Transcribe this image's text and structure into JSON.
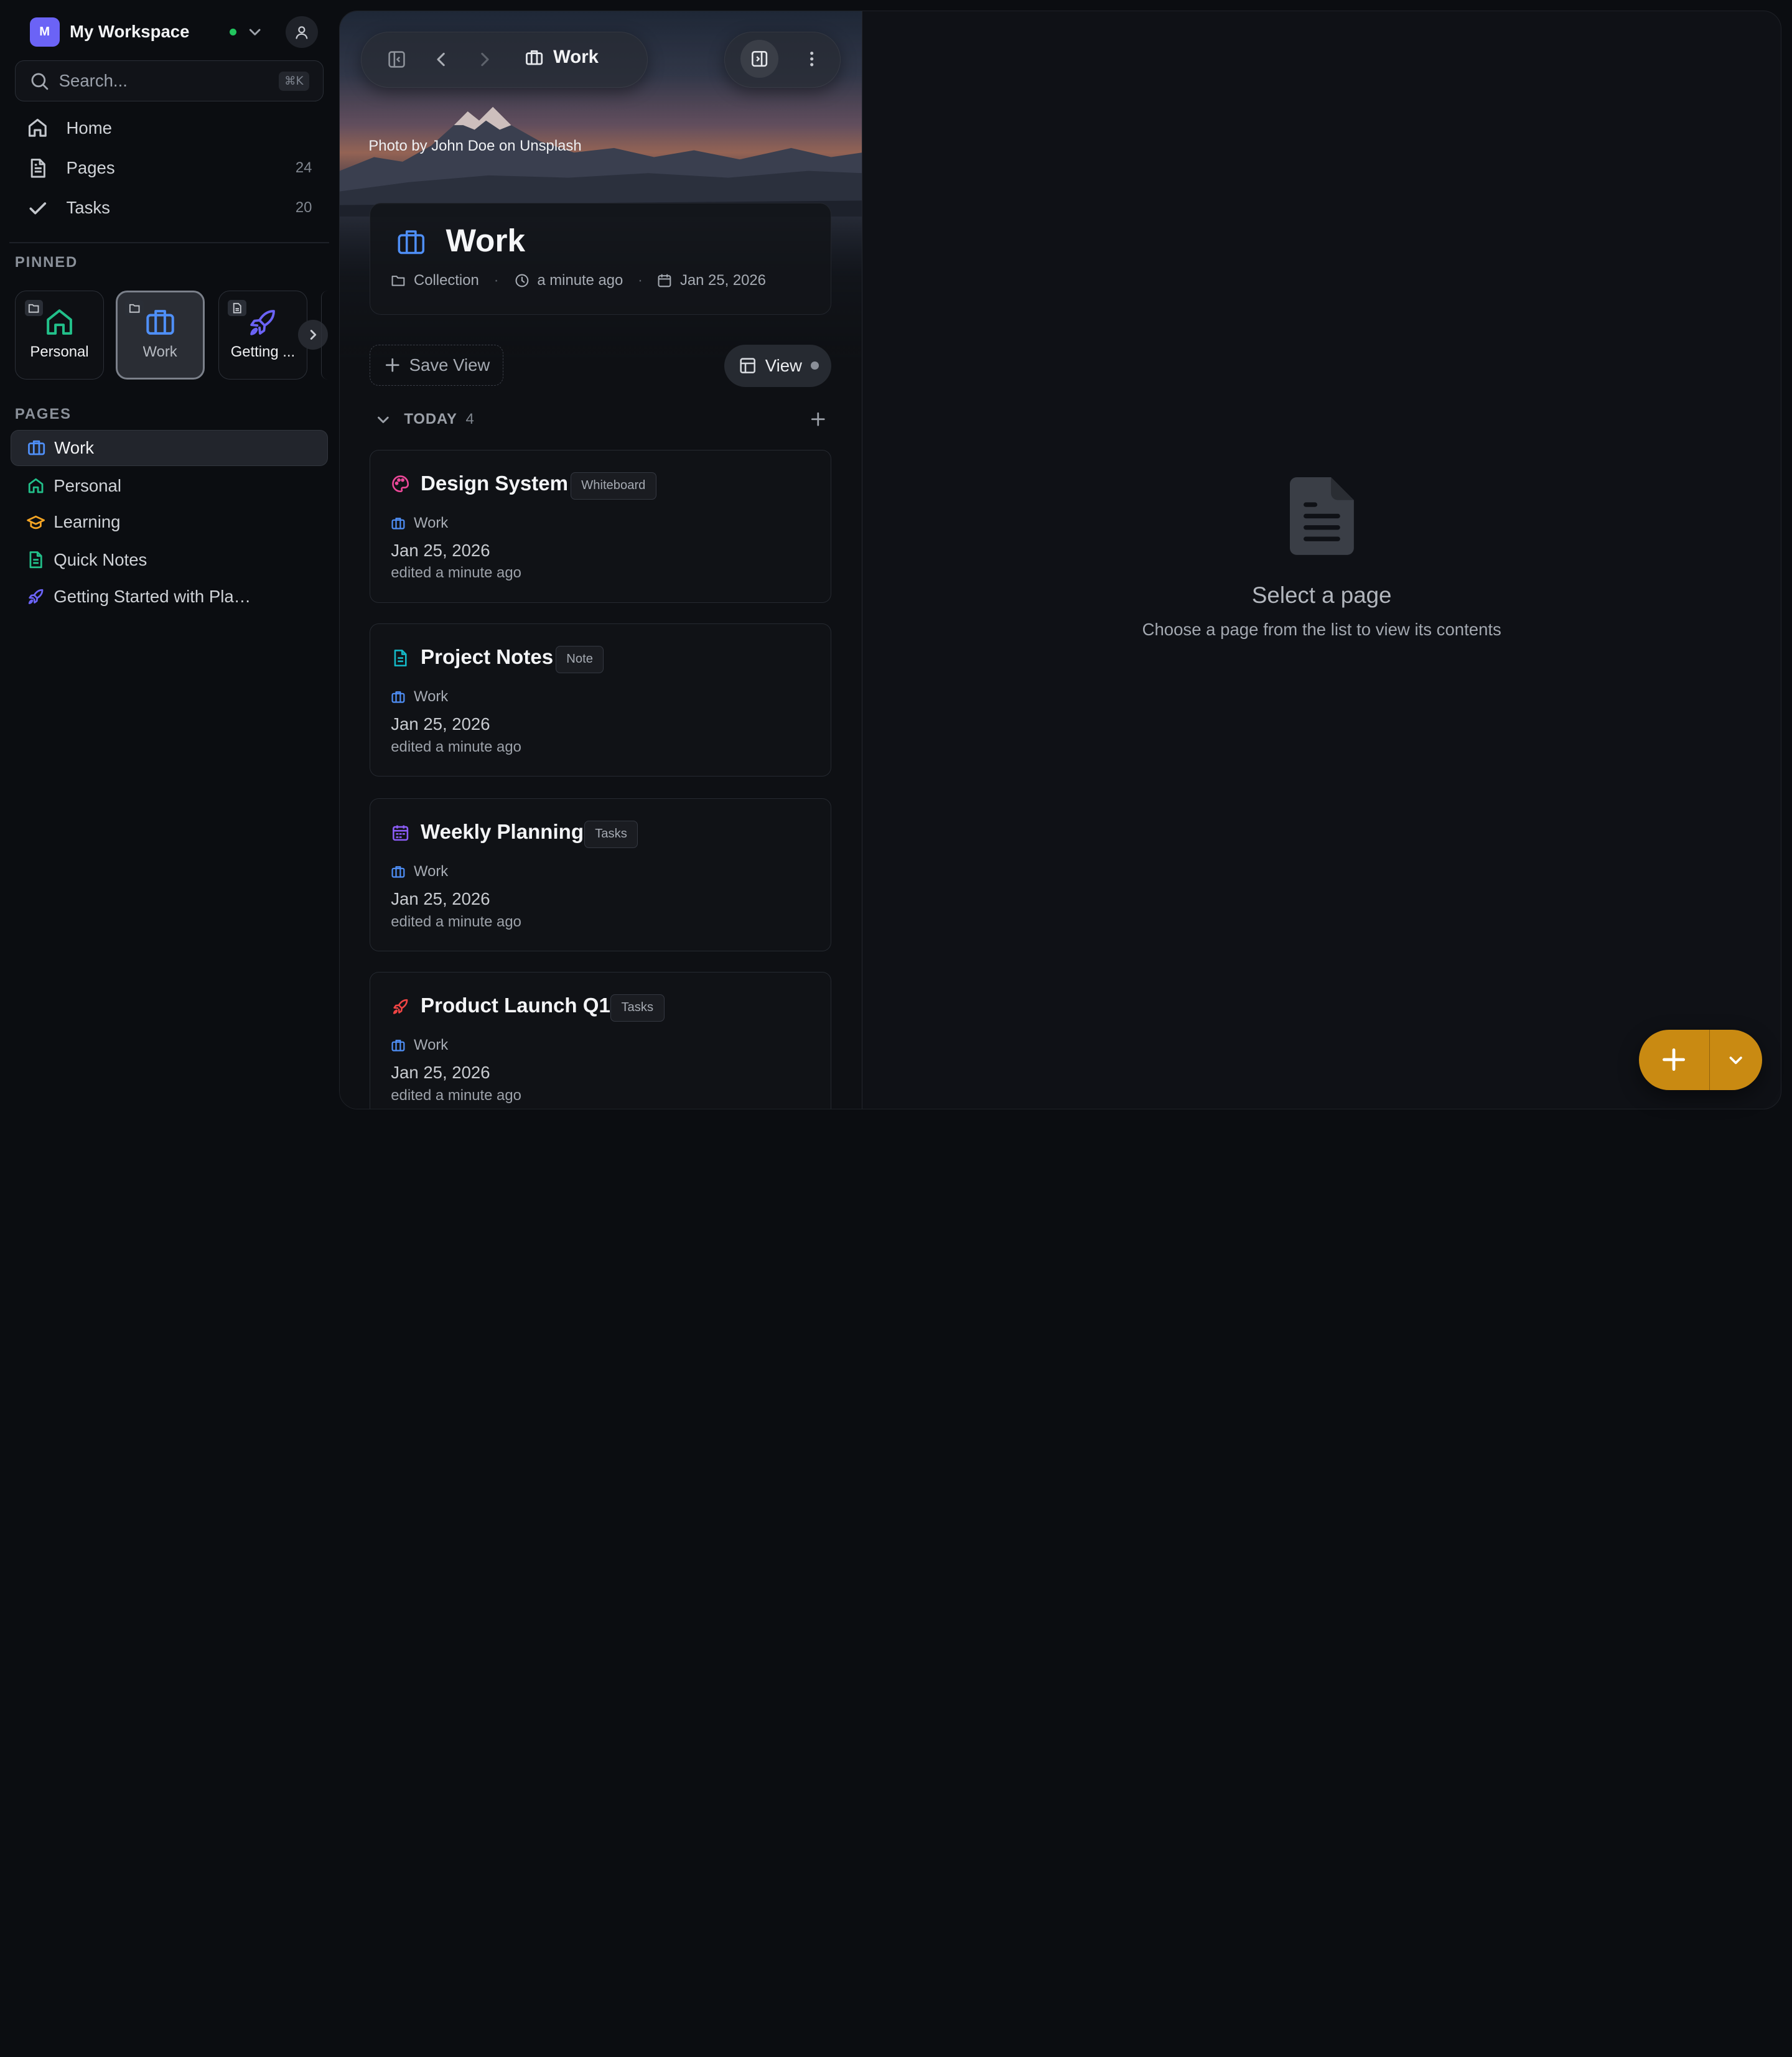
{
  "workspace": {
    "logo_letter": "M",
    "name": "My Workspace",
    "status_color": "#22c55e"
  },
  "search": {
    "placeholder": "Search...",
    "shortcut": "⌘K"
  },
  "nav": [
    {
      "label": "Home",
      "icon": "home-icon",
      "count": ""
    },
    {
      "label": "Pages",
      "icon": "page-icon",
      "count": "24"
    },
    {
      "label": "Tasks",
      "icon": "check-icon",
      "count": "20"
    }
  ],
  "pinned": {
    "label": "PINNED",
    "items": [
      {
        "label": "Personal",
        "icon": "home-icon",
        "color": "#22c08a",
        "active": false
      },
      {
        "label": "Work",
        "icon": "briefcase-icon",
        "color": "#4f8ff7",
        "active": true
      },
      {
        "label": "Getting ...",
        "icon": "rocket-icon",
        "color": "#6b63f6",
        "active": false
      }
    ]
  },
  "pages": {
    "label": "PAGES",
    "items": [
      {
        "label": "Work",
        "icon": "briefcase-icon",
        "color": "#4f8ff7",
        "active": true
      },
      {
        "label": "Personal",
        "icon": "home-icon",
        "color": "#22c08a",
        "active": false
      },
      {
        "label": "Learning",
        "icon": "graduation-cap-icon",
        "color": "#f5a524",
        "active": false
      },
      {
        "label": "Quick Notes",
        "icon": "note-icon",
        "color": "#22c08a",
        "active": false
      },
      {
        "label": "Getting Started with Pla…",
        "icon": "rocket-icon",
        "color": "#6b63f6",
        "active": false
      }
    ]
  },
  "header": {
    "title": "Work",
    "photo_credit": "Photo by John Doe on Unsplash"
  },
  "collection": {
    "title": "Work",
    "type": "Collection",
    "updated": "a minute ago",
    "date": "Jan 25, 2026"
  },
  "toolbar": {
    "save_view": "Save View",
    "view": "View"
  },
  "group": {
    "label": "TODAY",
    "count": "4"
  },
  "cards": [
    {
      "title": "Design System",
      "badge": "Whiteboard",
      "icon": "palette-icon",
      "color": "#ec4899",
      "collection": "Work",
      "date": "Jan 25, 2026",
      "edited": "edited a minute ago"
    },
    {
      "title": "Project Notes",
      "badge": "Note",
      "icon": "note-icon",
      "color": "#14b8c6",
      "collection": "Work",
      "date": "Jan 25, 2026",
      "edited": "edited a minute ago"
    },
    {
      "title": "Weekly Planning",
      "badge": "Tasks",
      "icon": "calendar-icon",
      "color": "#8b5cf6",
      "collection": "Work",
      "date": "Jan 25, 2026",
      "edited": "edited a minute ago"
    },
    {
      "title": "Product Launch Q1",
      "badge": "Tasks",
      "icon": "rocket-icon",
      "color": "#ef4444",
      "collection": "Work",
      "date": "Jan 25, 2026",
      "edited": "edited a minute ago"
    }
  ],
  "empty_state": {
    "title": "Select a page",
    "subtitle": "Choose a page from the list to view its contents"
  },
  "fab": {
    "color": "#c98a12"
  }
}
